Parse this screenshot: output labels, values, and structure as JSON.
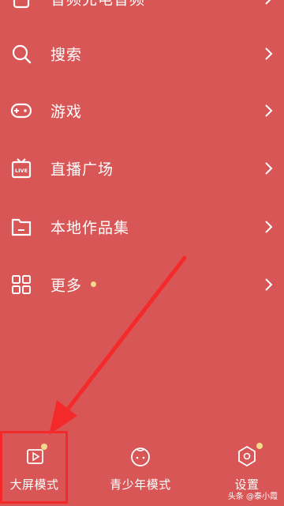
{
  "menu": {
    "items": [
      {
        "label": "音频充电音频",
        "icon": "document-icon"
      },
      {
        "label": "搜索",
        "icon": "search-icon"
      },
      {
        "label": "游戏",
        "icon": "gamepad-icon"
      },
      {
        "label": "直播广场",
        "icon": "live-tv-icon"
      },
      {
        "label": "本地作品集",
        "icon": "folder-icon"
      },
      {
        "label": "更多",
        "icon": "grid-icon"
      }
    ]
  },
  "live_badge": "LIVE",
  "bottom_bar": {
    "items": [
      {
        "label": "大屏模式",
        "icon": "tv-play-icon"
      },
      {
        "label": "青少年模式",
        "icon": "child-face-icon"
      },
      {
        "label": "设置",
        "icon": "settings-hex-icon"
      }
    ]
  },
  "watermark": "头条 @泰小霞",
  "colors": {
    "background": "#d95656",
    "text": "#ffffff",
    "notification_dot": "#f3d98c",
    "annotation_red": "#f42a2a"
  }
}
